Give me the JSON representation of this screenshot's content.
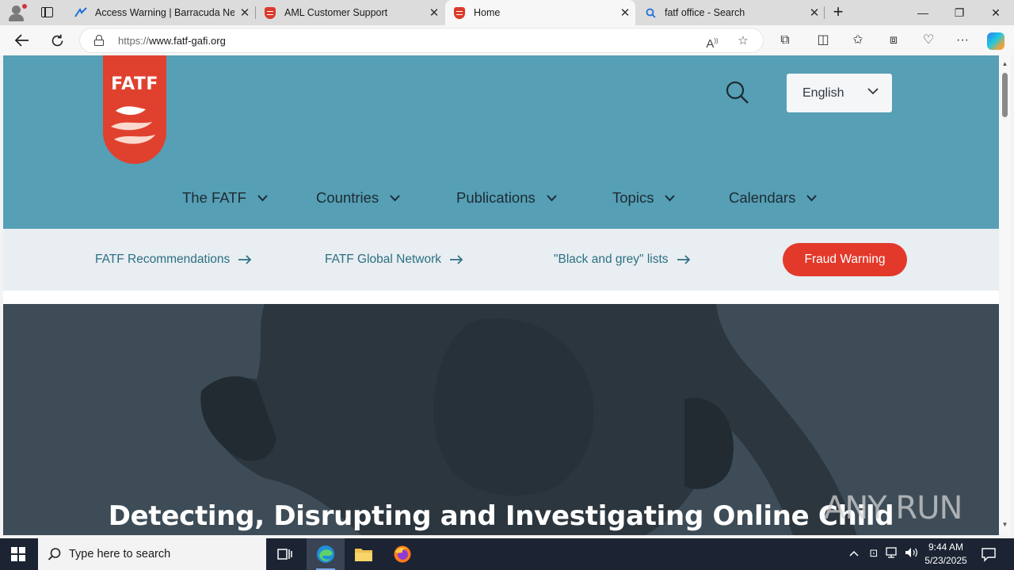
{
  "browser": {
    "tabs": [
      {
        "title": "Access Warning | Barracuda Netw",
        "favicon": "barracuda-icon",
        "active": false
      },
      {
        "title": "AML Customer Support",
        "favicon": "fatf-shield-icon",
        "active": false
      },
      {
        "title": "Home",
        "favicon": "fatf-shield-icon",
        "active": true
      },
      {
        "title": "fatf office - Search",
        "favicon": "search-icon",
        "active": false
      }
    ],
    "address": {
      "protocol": "https://",
      "host": "www.fatf-gafi.org"
    }
  },
  "site": {
    "logo_text": "FATF",
    "language": "English",
    "nav": [
      "The FATF",
      "Countries",
      "Publications",
      "Topics",
      "Calendars"
    ],
    "quick_links": [
      "FATF Recommendations",
      "FATF Global Network",
      "\"Black and grey\" lists"
    ],
    "fraud_button": "Fraud Warning",
    "hero_title": "Detecting, Disrupting and Investigating Online Child",
    "colors": {
      "header": "#569fb5",
      "accent": "#e2392b",
      "link": "#2d6f84",
      "quickbar": "#e8eef1"
    }
  },
  "watermark": "ANY RUN",
  "taskbar": {
    "search_placeholder": "Type here to search",
    "time": "9:44 AM",
    "date": "5/23/2025"
  }
}
